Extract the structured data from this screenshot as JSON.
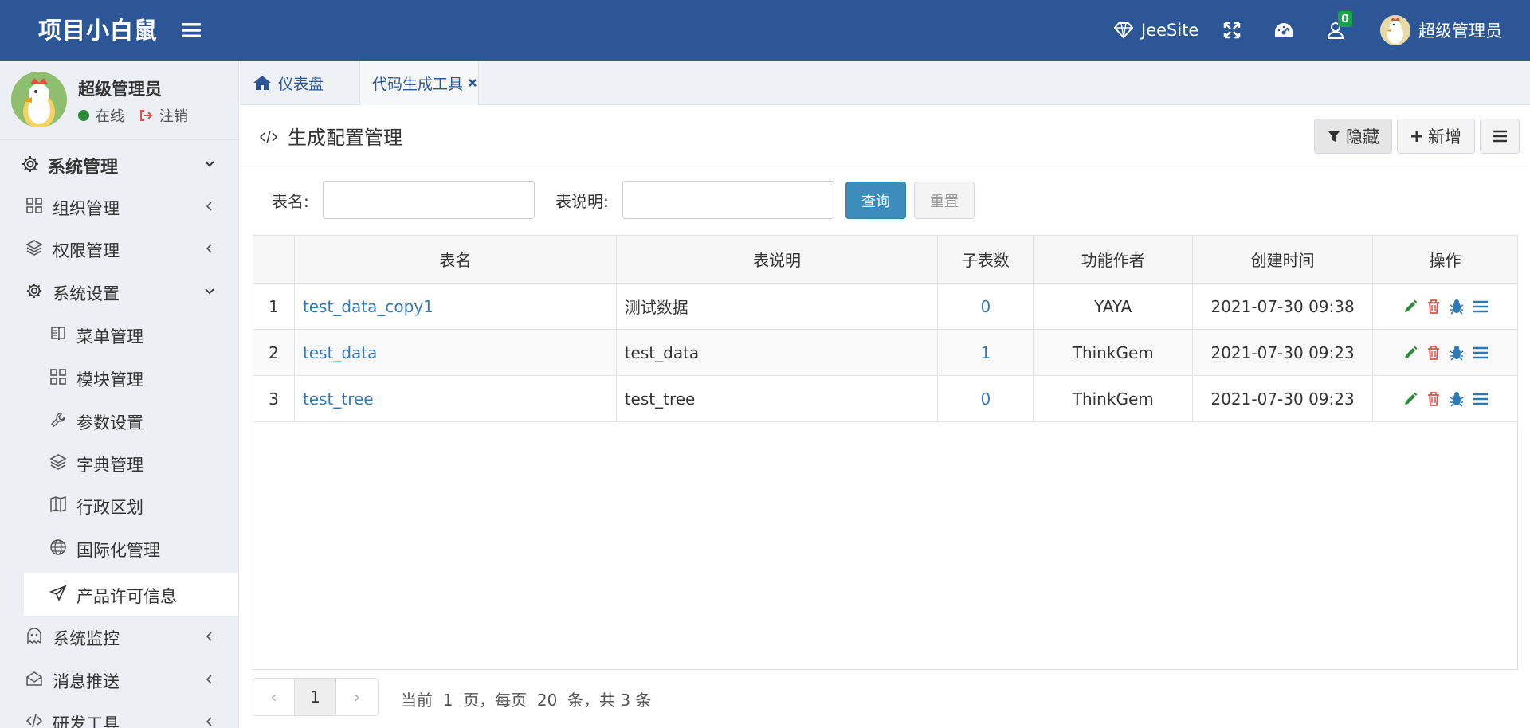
{
  "app": {
    "title": "项目小白鼠"
  },
  "topbar": {
    "jeesite_label": "JeeSite",
    "notify_count": "0",
    "user_name": "超级管理员"
  },
  "sidebar": {
    "user": {
      "name": "超级管理员",
      "status": "在线",
      "logout": "注销"
    },
    "items": [
      {
        "label": "系统管理",
        "icon": "gear-icon"
      },
      {
        "label": "组织管理",
        "icon": "grid-icon"
      },
      {
        "label": "权限管理",
        "icon": "layers-icon"
      },
      {
        "label": "系统设置",
        "icon": "gear-icon"
      },
      {
        "label": "菜单管理",
        "icon": "book-icon"
      },
      {
        "label": "模块管理",
        "icon": "grid-icon"
      },
      {
        "label": "参数设置",
        "icon": "wrench-icon"
      },
      {
        "label": "字典管理",
        "icon": "layers-icon"
      },
      {
        "label": "行政区划",
        "icon": "map-icon"
      },
      {
        "label": "国际化管理",
        "icon": "globe-icon"
      },
      {
        "label": "产品许可信息",
        "icon": "paper-plane-icon"
      },
      {
        "label": "系统监控",
        "icon": "ghost-icon"
      },
      {
        "label": "消息推送",
        "icon": "envelope-icon"
      },
      {
        "label": "研发工具",
        "icon": "code-icon"
      }
    ]
  },
  "tabs": [
    {
      "label": "仪表盘"
    },
    {
      "label": "代码生成工具"
    }
  ],
  "page": {
    "title": "生成配置管理",
    "hide_button": "隐藏",
    "add_button": "新增"
  },
  "filter": {
    "table_name_label": "表名:",
    "table_desc_label": "表说明:",
    "query_button": "查询",
    "reset_button": "重置",
    "table_name_value": "",
    "table_desc_value": ""
  },
  "table": {
    "headers": [
      "表名",
      "表说明",
      "子表数",
      "功能作者",
      "创建时间",
      "操作"
    ],
    "rows": [
      {
        "no": "1",
        "name": "test_data_copy1",
        "desc": "测试数据",
        "children": "0",
        "author": "YAYA",
        "created": "2021-07-30 09:38"
      },
      {
        "no": "2",
        "name": "test_data",
        "desc": "test_data",
        "children": "1",
        "author": "ThinkGem",
        "created": "2021-07-30 09:23"
      },
      {
        "no": "3",
        "name": "test_tree",
        "desc": "test_tree",
        "children": "0",
        "author": "ThinkGem",
        "created": "2021-07-30 09:23"
      }
    ]
  },
  "pagination": {
    "current_page": "1",
    "prev": "‹",
    "next": "›",
    "info": "当前  1  页，每页  20  条，共 3 条"
  },
  "colors": {
    "brand": "#2c5696",
    "link": "#337ab7",
    "query_button": "#3c8dbc",
    "edit": "#2e8b3c",
    "delete": "#e0504d",
    "debug": "#2c7ab5",
    "online": "#2e8b3c",
    "badge": "#1aa34a"
  }
}
